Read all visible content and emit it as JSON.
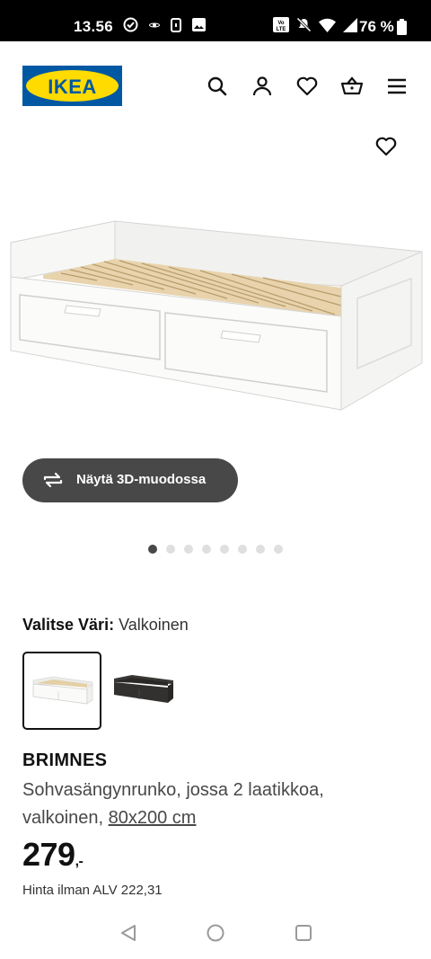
{
  "status_bar": {
    "time": "13.56",
    "battery_percent": "76 %"
  },
  "header": {
    "logo_text": "IKEA",
    "icons": [
      "search-icon",
      "account-icon",
      "favourites-icon",
      "shopping-bag-icon",
      "menu-icon"
    ]
  },
  "product": {
    "view_3d_label": "Näytä 3D-muodossa",
    "gallery": {
      "total": 8,
      "active_index": 0
    },
    "color_label": "Valitse Väri:",
    "color_value": "Valkoinen",
    "swatches": [
      "white",
      "black-brown"
    ],
    "name": "BRIMNES",
    "description": "Sohvasängynrunko, jossa 2 laatikkoa, valkoinen,",
    "size": "80x200 cm",
    "price": "279",
    "price_suffix": ",-",
    "price_ex_vat": "Hinta ilman ALV 222,31"
  },
  "colors": {
    "logo_blue": "#0058a3",
    "logo_yellow": "#ffdb00",
    "button_dark": "#484848"
  }
}
